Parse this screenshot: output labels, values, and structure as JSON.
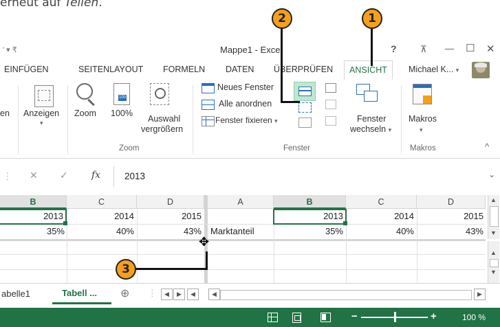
{
  "intro": {
    "text_prefix": "erneut auf ",
    "text_em": "Teilen",
    "text_suffix": "."
  },
  "callouts": [
    "1",
    "2",
    "3"
  ],
  "titlebar": {
    "qat": "' ▾ ₹",
    "title": "Mappe1 - Excel",
    "help": "?",
    "restore_ribbon": "⊼",
    "minimize": "—",
    "maximize": "☐",
    "close": "✕"
  },
  "tabs": [
    {
      "label": "EINFÜGEN"
    },
    {
      "label": "SEITENLAYOUT"
    },
    {
      "label": "FORMELN"
    },
    {
      "label": "DATEN"
    },
    {
      "label": "ÜBERPRÜFEN"
    },
    {
      "label": "ANSICHT",
      "active": true
    }
  ],
  "user": {
    "name": "Michael K...",
    "caret": "▾"
  },
  "ribbon": {
    "partial_left": "en",
    "anzeigen": "Anzeigen",
    "zoom": "Zoom",
    "zoom100": "100%",
    "auswahl1": "Auswahl",
    "auswahl2": "vergrößern",
    "zoom_group": "Zoom",
    "neues_fenster": "Neues Fenster",
    "alle_anordnen": "Alle anordnen",
    "fenster_fixieren": "Fenster fixieren",
    "fenster_wechseln1": "Fenster",
    "fenster_wechseln2": "wechseln",
    "fenster_group": "Fenster",
    "makros": "Makros",
    "makros_group": "Makros",
    "collapse": "^"
  },
  "formula": {
    "cancel": "✕",
    "enter": "✓",
    "fx": "fx",
    "value": "2013",
    "expand": "⌄"
  },
  "left_pane": {
    "columns": [
      "B",
      "C",
      "D"
    ],
    "rows": [
      [
        "2013",
        "2014",
        "2015"
      ],
      [
        "35%",
        "40%",
        "43%"
      ]
    ]
  },
  "right_pane": {
    "columns": [
      "A",
      "B",
      "C",
      "D"
    ],
    "rows": [
      [
        "",
        "2013",
        "2014",
        "2015"
      ],
      [
        "Marktanteil",
        "35%",
        "40%",
        "43%"
      ]
    ]
  },
  "sheets": {
    "first": "abelle1",
    "second": "Tabell ...",
    "add": "⊕"
  },
  "status": {
    "zoom": "100 %",
    "minus": "−",
    "plus": "+"
  }
}
